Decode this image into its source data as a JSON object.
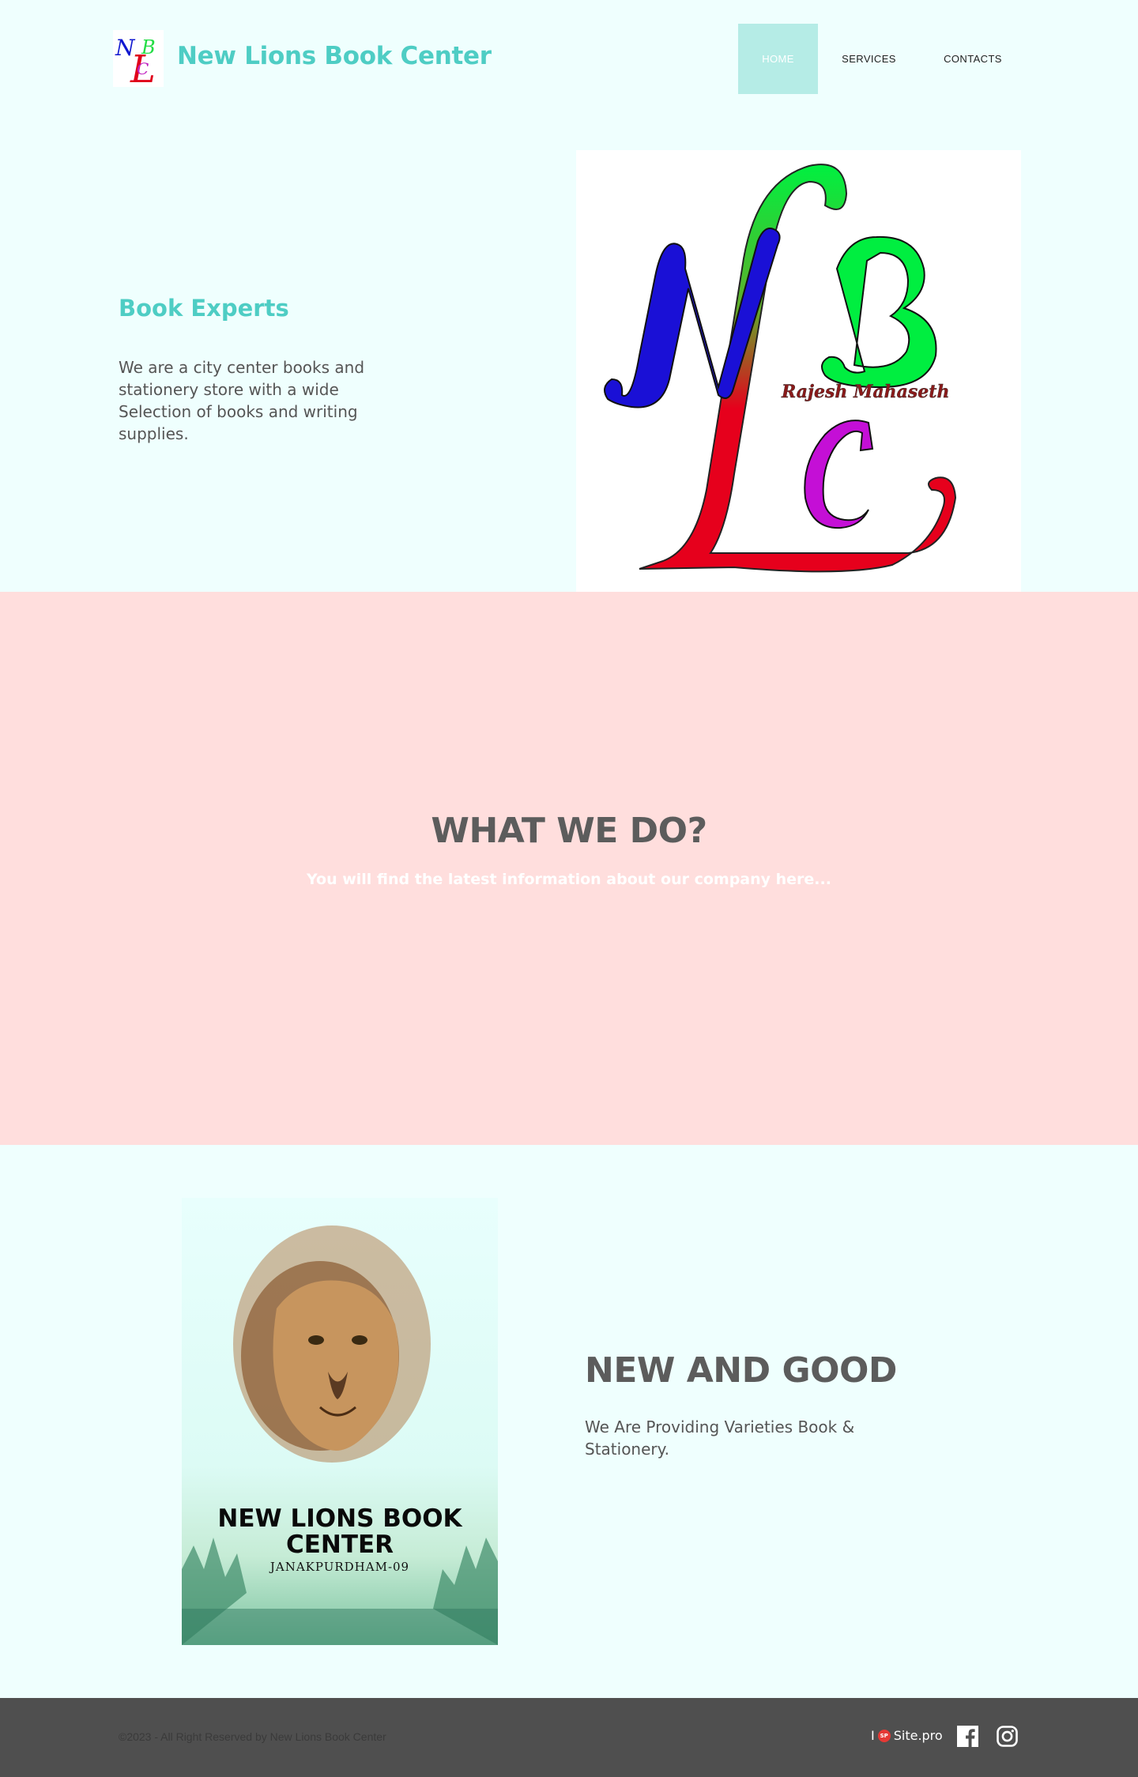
{
  "header": {
    "brand": "New Lions Book Center",
    "logo_letters": {
      "n": "N",
      "l": "L",
      "b": "B",
      "c": "C"
    },
    "nav": [
      {
        "label": "HOME",
        "active": true
      },
      {
        "label": "SERVICES",
        "active": false
      },
      {
        "label": "CONTACTS",
        "active": false
      }
    ]
  },
  "hero": {
    "title": "Book Experts",
    "text": "We are a city center books and stationery store with a wide Selection of books and writing supplies.",
    "logo_signature": "Rajesh Mahaseth"
  },
  "what_we_do": {
    "title": "WHAT WE DO?",
    "subtitle": "You will find the latest information about our company here..."
  },
  "new_and_good": {
    "poster_title": "NEW LIONS BOOK CENTER",
    "poster_subtitle": "JANAKPURDHAM-09",
    "title": "NEW AND GOOD",
    "text": "We Are Providing Varieties Book & Stationery."
  },
  "footer": {
    "copyright": "©2023 - All Right Reserved by New Lions Book Center",
    "sitepro_label": "Site.pro",
    "sitepro_badge": "SP",
    "sitepro_prefix": "I",
    "social": [
      "facebook-icon",
      "instagram-icon"
    ]
  },
  "colors": {
    "accent": "#4ecdc4",
    "page_bg": "#effffe",
    "band_bg": "#ffdedd",
    "footer_bg": "#4f4f4f",
    "nav_active_bg": "#b5ece6"
  }
}
